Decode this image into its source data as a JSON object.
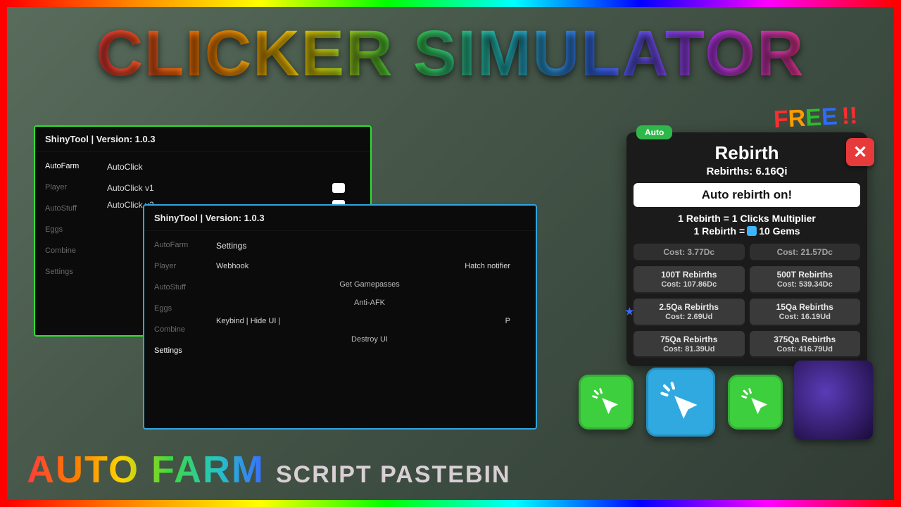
{
  "title": "CLICKER SIMULATOR",
  "caption": {
    "main": "AUTO FARM",
    "sub": "SCRIPT PASTEBIN"
  },
  "free_badge": {
    "letters": [
      "F",
      "R",
      "E",
      "E"
    ],
    "suffix": "!!"
  },
  "panel_green": {
    "title": "ShinyTool | Version: 1.0.3",
    "nav": [
      "AutoFarm",
      "Player",
      "AutoStuff",
      "Eggs",
      "Combine",
      "Settings"
    ],
    "active_nav": "AutoFarm",
    "section_heading": "AutoClick",
    "options": [
      "AutoClick v1",
      "AutoClick v2"
    ]
  },
  "panel_blue": {
    "title": "ShinyTool | Version: 1.0.3",
    "nav": [
      "AutoFarm",
      "Player",
      "AutoStuff",
      "Eggs",
      "Combine",
      "Settings"
    ],
    "active_nav": "Settings",
    "section_heading": "Settings",
    "webhook_label": "Webhook",
    "hatch_label": "Hatch notifier",
    "buttons": [
      "Get Gamepasses",
      "Anti-AFK",
      "Destroy UI"
    ],
    "keybind_label": "Keybind | Hide UI |",
    "keybind_value": "P"
  },
  "rebirth": {
    "tag": "Auto",
    "title": "Rebirth",
    "count": "Rebirths: 6.16Qi",
    "pill": "Auto rebirth on!",
    "info1_left": "1 Rebirth =",
    "info1_right": "1 Clicks Multiplier",
    "info2_left": "1 Rebirth =",
    "info2_right": "10 Gems",
    "buttons": [
      {
        "line1": "Cost: 3.77Dc",
        "line2": "",
        "cut": true
      },
      {
        "line1": "Cost: 21.57Dc",
        "line2": "",
        "cut": true
      },
      {
        "line1": "100T Rebirths",
        "line2": "Cost: 107.86Dc"
      },
      {
        "line1": "500T Rebirths",
        "line2": "Cost: 539.34Dc"
      },
      {
        "line1": "2.5Qa Rebirths",
        "line2": "Cost: 2.69Ud",
        "star": true
      },
      {
        "line1": "15Qa Rebirths",
        "line2": "Cost: 16.19Ud"
      },
      {
        "line1": "75Qa Rebirths",
        "line2": "Cost: 81.39Ud"
      },
      {
        "line1": "375Qa Rebirths",
        "line2": "Cost: 416.79Ud"
      }
    ]
  }
}
